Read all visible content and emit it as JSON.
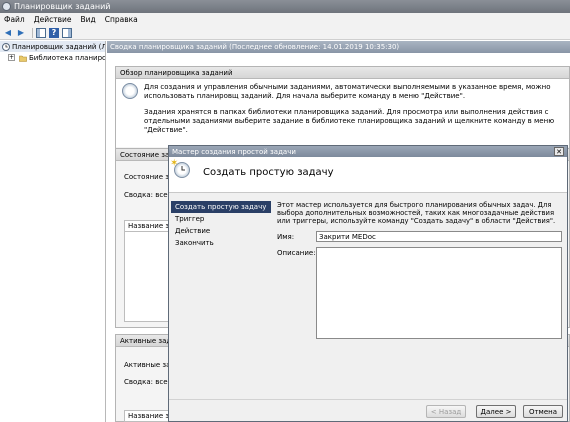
{
  "window": {
    "title": "Планировщик заданий"
  },
  "menu": [
    "Файл",
    "Действие",
    "Вид",
    "Справка"
  ],
  "toolbar": {
    "back": "◀",
    "forward": "▶",
    "help": "?"
  },
  "tree": {
    "root": "Планировщик заданий (Локал",
    "library": "Библиотека планировщ"
  },
  "main": {
    "header": "Сводка планировщика заданий (Последнее обновление: 14.01.2019 10:35:30)",
    "overview_title": "Обзор планировщика заданий",
    "overview_p1": "Для создания и управления обычными заданиями, автоматически выполняемыми в указанное время, можно использовать планировщ заданий. Для начала выберите команду в меню \"Действие\".",
    "overview_p2": "Задания хранятся в папках библиотеки планировщика заданий. Для просмотра или выполнения действия с отдельными заданиями выберите задание в библиотеке планировщика заданий и щелкните команду в меню \"Действие\".",
    "status_title": "Состояние зада",
    "status_label": "Состояние зад",
    "status_summary": "Сводка: всего",
    "status_col": "Название зада",
    "active_title": "Активные задач",
    "active_label": "Активные зад",
    "active_summary": "Сводка: всего",
    "active_col": "Название зада"
  },
  "wizard": {
    "title": "Мастер создания простой задачи",
    "close": "✕",
    "heading": "Создать простую задачу",
    "steps": [
      "Создать простую задачу",
      "Триггер",
      "Действие",
      "Закончить"
    ],
    "description": "Этот мастер используется для быстрого планирования обычных задач. Для выбора дополнительных возможностей, таких как многозадачные действия или триггеры, используйте команду \"Создать задачу\" в области \"Действия\".",
    "name_label": "Имя:",
    "name_value": "Закрити MEDoc",
    "desc_label": "Описание:",
    "btn_back": "< Назад",
    "btn_next": "Далее >",
    "btn_cancel": "Отмена"
  },
  "colors": {
    "active_step": "#2a3f66",
    "title_gray": "#7d8a9c"
  }
}
